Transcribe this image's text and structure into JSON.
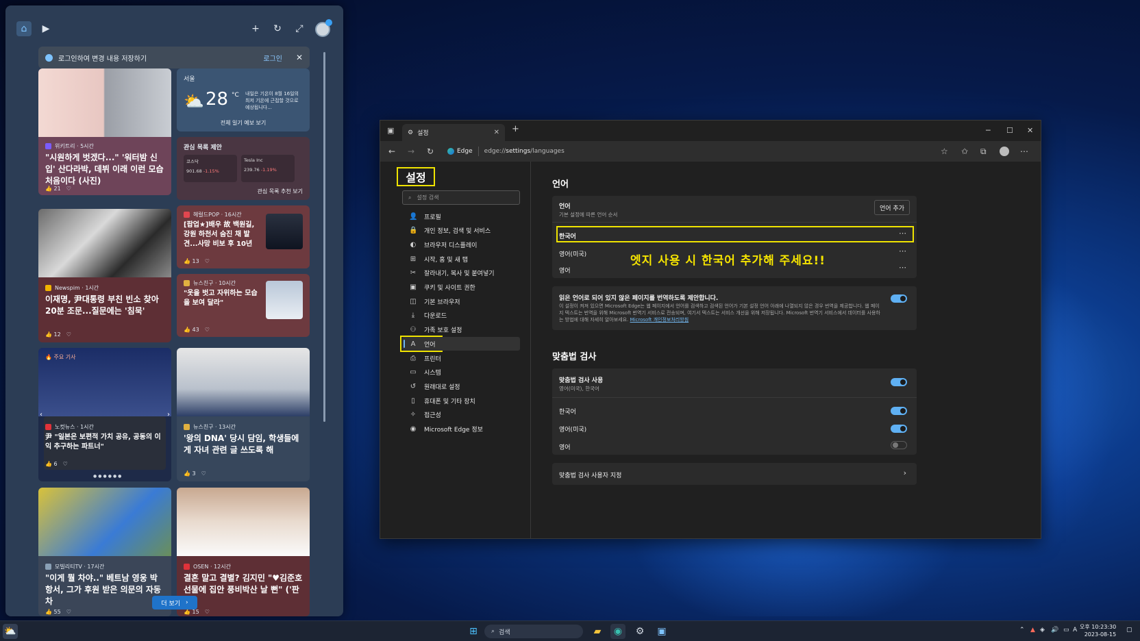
{
  "widgets": {
    "signin": {
      "message": "로그인하여 변경 내용 저장하기",
      "link": "로그인"
    },
    "weather": {
      "city": "서울",
      "temp": "28",
      "unit": "°C",
      "note": "내일은 기온이 8월 16일의 최저 기온에 근접할 것으로 예상됩니다...",
      "button": "전체 일기 예보 보기"
    },
    "watchlist": {
      "title": "관심 목록 제안",
      "stocks": [
        {
          "name": "코스닥",
          "value": "901.68",
          "change": "-1.15%"
        },
        {
          "name": "Tesla Inc",
          "value": "239.76",
          "change": "-1.19%"
        }
      ],
      "button": "관심 목록 추천 보기"
    },
    "cards": [
      {
        "source": "위키트리 · 5시간",
        "headline": "\"시원하게 벗겠다...\" '워터밤 신입' 산다라박, 데뷔 이래 이런 모습 처음이다 (사진)",
        "likes": "21"
      },
      {
        "source": "헤럴드POP · 16시간",
        "headline": "[팝업★]배우 故 백원길, 강원 하천서 숨진 채 발견...사망 비보 후 10년",
        "likes": "13"
      },
      {
        "source": "Newspim · 1시간",
        "headline": "이재명, 尹대통령 부친 빈소 찾아 20분 조문...질문에는 '침묵'",
        "likes": "12"
      },
      {
        "source": "뉴스친구 · 10시간",
        "headline": "\"옷을 벗고 자위하는 모습을 보여 달라\"",
        "likes": "43"
      },
      {
        "tag": "주요 기사",
        "source": "노컷뉴스 · 1시간",
        "headline": "尹 \"일본은 보편적 가치 공유, 공동의 이익 추구하는 파트너\"",
        "likes": "6"
      },
      {
        "source": "뉴스친구 · 13시간",
        "headline": "'왕의 DNA' 당시 담임, 학생들에게 자녀 관련 글 쓰도록 해",
        "likes": "3"
      },
      {
        "source": "모빌리티TV · 17시간",
        "headline": "\"이게 뭘 차야..\" 베트남 영웅 박항서, 그가 후원 받은 의문의 자동차",
        "likes": "55"
      },
      {
        "source": "OSEN · 12시간",
        "headline": "결혼 말고 결별? 김지민 \"♥김준호 선물에 집안 풍비박산 날 뻔\" ('판도')",
        "likes": "15"
      }
    ],
    "more_button": "더 보기"
  },
  "edge": {
    "tab_title": "설정",
    "url_chip": "Edge",
    "url_prefix": "edge://",
    "url_bold": "settings",
    "url_suffix": "/languages",
    "settings_title": "설정",
    "search_placeholder": "설정 검색",
    "nav": [
      {
        "label": "프로필",
        "icon": "👤"
      },
      {
        "label": "개인 정보, 검색 및 서비스",
        "icon": "🔒"
      },
      {
        "label": "브라우저 디스플레이",
        "icon": "◐"
      },
      {
        "label": "시작, 홈 및 새 탭",
        "icon": "⊞"
      },
      {
        "label": "잘라내기, 복사 및 붙여넣기",
        "icon": "✂"
      },
      {
        "label": "쿠키 및 사이트 권한",
        "icon": "▣"
      },
      {
        "label": "기본 브라우저",
        "icon": "◫"
      },
      {
        "label": "다운로드",
        "icon": "⤓"
      },
      {
        "label": "가족 보호 설정",
        "icon": "⚇"
      },
      {
        "label": "언어",
        "icon": "A"
      },
      {
        "label": "프린터",
        "icon": "⎙"
      },
      {
        "label": "시스템",
        "icon": "▭"
      },
      {
        "label": "원래대로 설정",
        "icon": "↺"
      },
      {
        "label": "휴대폰 및 기타 장치",
        "icon": "▯"
      },
      {
        "label": "접근성",
        "icon": "✧"
      },
      {
        "label": "Microsoft Edge 정보",
        "icon": "◉"
      }
    ],
    "language_section": {
      "title": "언어",
      "header_label": "언어",
      "header_sub": "기본 설정에 따른 언어 순서",
      "add_button": "언어 추가",
      "languages": [
        "한국어",
        "영어(미국)",
        "영어"
      ],
      "annotation": "엣지 사용 시 한국어 추가해 주세요!!",
      "translate_label": "읽은 언어로 되어 있지 않은 페이지를 번역하도록 제안합니다.",
      "translate_desc": "이 설정이 켜져 있으면 Microsoft Edge는 웹 페이지에서 언어를 검색하고 검색된 언어가 기본 설정 언어 아래에 나열되지 않은 경우 번역을 제공합니다. 웹 페이지 텍스트는 번역을 위해 Microsoft 번역기 서비스로 전송되며, 여기서 텍스트는 서비스 개선을 위해 저장됩니다. Microsoft 번역기 서비스에서 데이터를 사용하는 방법에 대해 자세히 알아보세요.",
      "translate_link": "Microsoft 개인정보처리방침",
      "translate_on": true
    },
    "spell_section": {
      "title": "맞춤법 검사",
      "enable_label": "맞춤법 검사 사용",
      "enable_sub": "영어(미국), 한국어",
      "enable_on": true,
      "items": [
        {
          "label": "한국어",
          "on": true
        },
        {
          "label": "영어(미국)",
          "on": true
        },
        {
          "label": "영어",
          "on": false
        }
      ],
      "custom_label": "맞춤법 검사 사용자 지정"
    }
  },
  "taskbar": {
    "search": "검색",
    "clock_time": "오후 10:23:30",
    "clock_date": "2023-08-15",
    "ime": "A"
  }
}
